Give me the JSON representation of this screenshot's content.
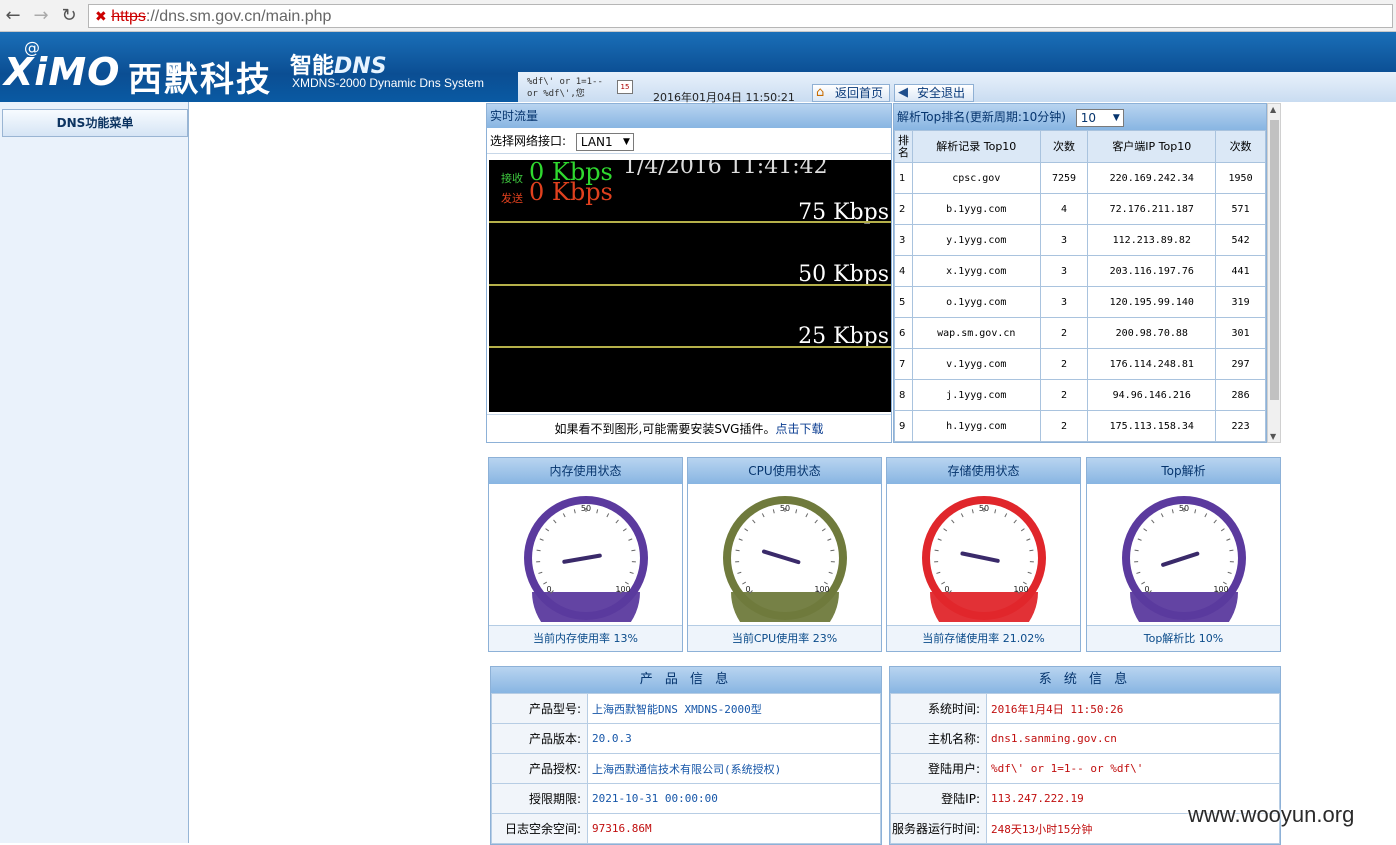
{
  "browser": {
    "url_scheme": "https",
    "url_rest": "://dns.sm.gov.cn/main.php"
  },
  "header": {
    "logo_en": "XiMO",
    "logo_cn": "西默科技",
    "logo_smart": "智能",
    "logo_dns": "DNS",
    "subtitle": "XMDNS-2000 Dynamic Dns System",
    "injected_text": "%df\\' or 1=1-- or %df\\',您",
    "datetime": "2016年01月04日 11:50:21",
    "home_button": "返回首页",
    "logout_button": "安全退出"
  },
  "sidebar": {
    "title": "DNS功能菜单"
  },
  "traffic": {
    "title": "实时流量",
    "interface_label": "选择网络接口:",
    "interface_value": "LAN1",
    "rx_label": "接收",
    "rx_value": "0 Kbps",
    "tx_label": "发送",
    "tx_value": "0 Kbps",
    "timestamp": "1/4/2016 11:41:42",
    "levels": [
      {
        "label": "75 Kbps",
        "value": 75
      },
      {
        "label": "50 Kbps",
        "value": 50
      },
      {
        "label": "25 Kbps",
        "value": 25
      }
    ],
    "hint": "如果看不到图形,可能需要安装SVG插件。",
    "hint_link": "点击下载"
  },
  "top10": {
    "title": "解析Top排名(更新周期:10分钟)",
    "select_value": "10",
    "columns": [
      "排名",
      "解析记录 Top10",
      "次数",
      "客户端IP Top10",
      "次数"
    ],
    "rows": [
      {
        "rank": "1",
        "record": "cpsc.gov",
        "count": "7259",
        "ip": "220.169.242.34",
        "ipcount": "1950"
      },
      {
        "rank": "2",
        "record": "b.1yyg.com",
        "count": "4",
        "ip": "72.176.211.187",
        "ipcount": "571"
      },
      {
        "rank": "3",
        "record": "y.1yyg.com",
        "count": "3",
        "ip": "112.213.89.82",
        "ipcount": "542"
      },
      {
        "rank": "4",
        "record": "x.1yyg.com",
        "count": "3",
        "ip": "203.116.197.76",
        "ipcount": "441"
      },
      {
        "rank": "5",
        "record": "o.1yyg.com",
        "count": "3",
        "ip": "120.195.99.140",
        "ipcount": "319"
      },
      {
        "rank": "6",
        "record": "wap.sm.gov.cn",
        "count": "2",
        "ip": "200.98.70.88",
        "ipcount": "301"
      },
      {
        "rank": "7",
        "record": "v.1yyg.com",
        "count": "2",
        "ip": "176.114.248.81",
        "ipcount": "297"
      },
      {
        "rank": "8",
        "record": "j.1yyg.com",
        "count": "2",
        "ip": "94.96.146.216",
        "ipcount": "286"
      },
      {
        "rank": "9",
        "record": "h.1yyg.com",
        "count": "2",
        "ip": "175.113.158.34",
        "ipcount": "223"
      }
    ]
  },
  "gauges": [
    {
      "title": "内存使用状态",
      "footer": "当前内存使用率 13%",
      "value": 13,
      "color": "#5b3a9e"
    },
    {
      "title": "CPU使用状态",
      "footer": "当前CPU使用率 23%",
      "value": 23,
      "color": "#6f7a3c"
    },
    {
      "title": "存储使用状态",
      "footer": "当前存储使用率 21.02%",
      "value": 21.02,
      "color": "#e0262b"
    },
    {
      "title": "Top解析",
      "footer": "Top解析比 10%",
      "value": 10,
      "color": "#5b3a9e"
    }
  ],
  "gauge_scale": {
    "min_label": "0",
    "mid_label": "50",
    "max_label": "100"
  },
  "product_info": {
    "title": "产 品 信 息",
    "rows": [
      {
        "key": "产品型号:",
        "value": "上海西默智能DNS XMDNS-2000型"
      },
      {
        "key": "产品版本:",
        "value": "20.0.3"
      },
      {
        "key": "产品授权:",
        "value": "上海西默通信技术有限公司(系统授权)"
      },
      {
        "key": "授限期限:",
        "value": "2021-10-31 00:00:00"
      },
      {
        "key": "日志空余空间:",
        "value": "97316.86M"
      }
    ]
  },
  "system_info": {
    "title": "系 统 信 息",
    "rows": [
      {
        "key": "系统时间:",
        "value": "2016年1月4日 11:50:26"
      },
      {
        "key": "主机名称:",
        "value": "dns1.sanming.gov.cn"
      },
      {
        "key": "登陆用户:",
        "value": "%df\\' or 1=1-- or %df\\'"
      },
      {
        "key": "登陆IP:",
        "value": "113.247.222.19"
      },
      {
        "key": "服务器运行时间:",
        "value": "248天13小时15分钟"
      }
    ]
  },
  "watermark": "www.wooyun.org"
}
